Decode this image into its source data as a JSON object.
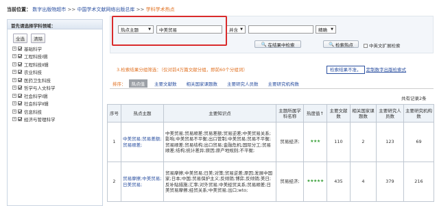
{
  "breadcrumb": {
    "label": "当前位置：",
    "items": [
      "数字出版物超市",
      "中国学术文献网络出版总库",
      "学科学术热点"
    ],
    "separator": " >> "
  },
  "sidebar": {
    "title": "首先请选择学科领域：",
    "select_all": "全选",
    "clear": "清除",
    "items": [
      {
        "label": "基础科学"
      },
      {
        "label": "工程科技Ⅰ辑"
      },
      {
        "label": "工程科技Ⅱ辑"
      },
      {
        "label": "农业科技"
      },
      {
        "label": "医药卫生科技"
      },
      {
        "label": "哲学与人文科学"
      },
      {
        "label": "社会科学Ⅰ辑"
      },
      {
        "label": "社会科学Ⅱ辑"
      },
      {
        "label": "信息科技"
      },
      {
        "label": "经济与管理科学"
      }
    ]
  },
  "search": {
    "field_select": "热点主题",
    "keyword": "中美贸易",
    "logic_select": "并含",
    "second_keyword": "",
    "match_select": "精确",
    "btn_search_in_results": "在结果中检索",
    "btn_search": "检索热点",
    "cn_en_expand": "中英文扩展检索"
  },
  "results": {
    "grouping_text": "3.检索结果分组筛选：（仅对前4万篇文献分组，即前60个分组词）",
    "feedback_prefix": "检索结果不准，",
    "feedback_link": "定制数字出版检索式"
  },
  "sort": {
    "label": "排序：",
    "options": [
      "热点值",
      "主要文献数",
      "相关国家课题数",
      "主要研究人员数",
      "主要研究机构数"
    ]
  },
  "total_records": "共有记录2条",
  "table": {
    "headers": [
      "序号",
      "热点主题",
      "主要知识点",
      "主题所属学科名称",
      "热度值↑",
      "主要文献数",
      "相关国家课题数",
      "主要研究人员数",
      "主要研究机构数"
    ],
    "rows": [
      {
        "index": "1",
        "topic": "中美贸易;贸易差额;贸易顺差;",
        "knowledge": "中美贸易;贸易顺差;贸易差额;贸易逆差;中美贸易关系;影响;中美贸易不平衡;出口管制;中美贸易;贸易不平衡;贸易顺差;贸易结构;出口贸易;金融危机;国际分工;贸易顺差;结构;统计差异;原因;原产地规则;不平衡;",
        "discipline": "贸易经济;",
        "heat": "★★★",
        "docs": "110",
        "projects": "2",
        "researchers": "123",
        "institutions": "69"
      },
      {
        "index": "2",
        "topic": "贸易摩擦;中美贸易;日美贸易;",
        "knowledge": "贸易摩擦;中美贸易;日美;对策;贸易逆差;原因;发展中国家;日本;中国;贸易保护主义;反倾销;博弈;反倾销;美日;反补贴措施;汇率;对外贸易;中美经贸关系;贸易顺差;日美贸易摩擦;经贸关系;中美贸易;出口;wto;",
        "discipline": "贸易经济;",
        "heat": "★★★★★",
        "docs": "435",
        "projects": "4",
        "researchers": "379",
        "institutions": "216"
      }
    ]
  },
  "colors": {
    "link": "#2a4fa0",
    "accent_orange": "#e07020",
    "highlight_red": "#d92a2a",
    "stars_green": "#3aa03a"
  }
}
